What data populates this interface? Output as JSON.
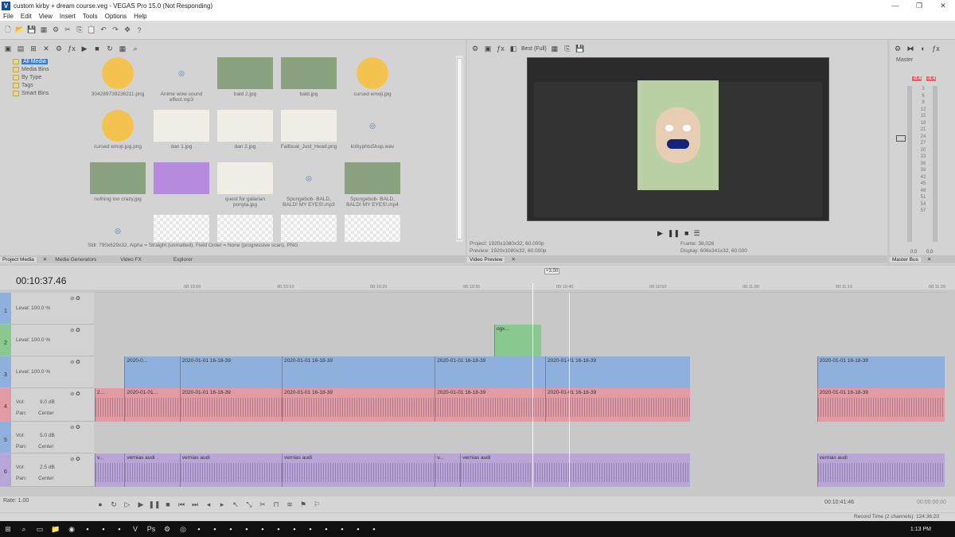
{
  "window": {
    "title": "custom kirby + dream course.veg - VEGAS Pro 15.0 (Not Responding)",
    "app_icon": "V"
  },
  "menu": [
    "File",
    "Edit",
    "View",
    "Insert",
    "Tools",
    "Options",
    "Help"
  ],
  "media_tree": [
    {
      "label": "All Media",
      "selected": true
    },
    {
      "label": "Media Bins"
    },
    {
      "label": "By Type"
    },
    {
      "label": "Tags"
    },
    {
      "label": "Smart Bins"
    }
  ],
  "media_items": [
    {
      "name": "304289739236211.png",
      "kind": "emoji"
    },
    {
      "name": "Anime wow sound effect.mp3",
      "kind": "audio"
    },
    {
      "name": "bald 2.jpg",
      "kind": "photo"
    },
    {
      "name": "bald.jpg",
      "kind": "photo"
    },
    {
      "name": "cursed emoji.jpg",
      "kind": "emoji"
    },
    {
      "name": "cursed emoji.jpg.png",
      "kind": "emoji"
    },
    {
      "name": "dan 1.jpg",
      "kind": "drawing"
    },
    {
      "name": "dan 2.jpg",
      "kind": "drawing"
    },
    {
      "name": "Failboat_Just_Head.png",
      "kind": "drawing"
    },
    {
      "name": "kirbyphto5hop.wav",
      "kind": "audio"
    },
    {
      "name": "nothing too crazy.jpg",
      "kind": "photo"
    },
    {
      "name": "",
      "kind": "purple"
    },
    {
      "name": "quest for galarian ponyta.jpg",
      "kind": "drawing"
    },
    {
      "name": "Spongebob- BALD, BALD! MY EYES!.mp3",
      "kind": "audio"
    },
    {
      "name": "Spongebob- BALD, BALD! MY EYES!.mp4",
      "kind": "photo"
    },
    {
      "name": "",
      "kind": "audio"
    },
    {
      "name": "",
      "kind": "checker"
    },
    {
      "name": "",
      "kind": "checker"
    },
    {
      "name": "",
      "kind": "checker"
    },
    {
      "name": "",
      "kind": "checker"
    }
  ],
  "media_status": "Still: 790x629x32, Alpha = Straight (unmatted), Field Order = None (progressive scan), PNG",
  "left_tabs": [
    "Project Media",
    "Media Generators",
    "Video FX",
    "Explorer"
  ],
  "preview": {
    "quality": "Best (Full)",
    "project": "Project:  1920x1080x32, 60.000p",
    "preview": "Preview:  1920x1080x32, 60.000p",
    "frame": "Frame:     38,026",
    "display": "Display:   606x341x32, 60.000",
    "tab": "Video Preview"
  },
  "master": {
    "label": "Master",
    "tab": "Master Bus",
    "peak_left": "-9.4",
    "peak_right": "-9.4",
    "scale": [
      "3",
      "6",
      "9",
      "12",
      "15",
      "18",
      "21",
      "24",
      "27",
      "30",
      "33",
      "36",
      "39",
      "42",
      "45",
      "48",
      "51",
      "54",
      "57"
    ],
    "bottom_left": "0.0",
    "bottom_right": "0.0"
  },
  "timeline": {
    "timecode": "00:10:37.46",
    "rate_marker": "+3.00",
    "ruler": [
      "00:10:00",
      "00:10:10",
      "00:10:20",
      "00:10:30",
      "00:10:40",
      "00:10:50",
      "00:11:00",
      "00:11:10",
      "00:11:20"
    ],
    "tracks": [
      {
        "num": "1",
        "label": "Level: 100.0 %",
        "color": "#8fb0dc",
        "type": "video"
      },
      {
        "num": "2",
        "label": "Level: 100.0 %",
        "color": "#89c98f",
        "type": "video"
      },
      {
        "num": "3",
        "label": "Level: 100.0 %",
        "color": "#8fb0dc",
        "type": "video"
      },
      {
        "num": "4",
        "vol": "Vol:",
        "vol_val": "9.0 dB",
        "pan": "Pan:",
        "pan_val": "Center",
        "color": "#e29aa3",
        "type": "audio"
      },
      {
        "num": "5",
        "vol": "Vol:",
        "vol_val": "5.0 dB",
        "pan": "Pan:",
        "pan_val": "Center",
        "color": "#8fb0dc",
        "type": "audio"
      },
      {
        "num": "6",
        "vol": "Vol:",
        "vol_val": "2.5 dB",
        "pan": "Pan:",
        "pan_val": "Center",
        "color": "#b8a6d8",
        "type": "audio"
      }
    ],
    "clips": {
      "t2": [
        {
          "name": "ogx...",
          "start": 0.47,
          "end": 0.525
        }
      ],
      "t3": [
        {
          "name": "2020-0...",
          "start": 0.035,
          "end": 0.1
        },
        {
          "name": "2020-01-01 16-18-39",
          "start": 0.1,
          "end": 0.22
        },
        {
          "name": "2020-01-01 16-18-39",
          "start": 0.22,
          "end": 0.4
        },
        {
          "name": "2020-01-01 16-18-39",
          "start": 0.4,
          "end": 0.53
        },
        {
          "name": "2020-01-01 16-18-39",
          "start": 0.53,
          "end": 0.7
        },
        {
          "name": "2020-01-01 16-18-39",
          "start": 0.85,
          "end": 1.0
        }
      ],
      "t4": [
        {
          "name": "2...",
          "start": 0.0,
          "end": 0.035
        },
        {
          "name": "2020-01-01...",
          "start": 0.035,
          "end": 0.1
        },
        {
          "name": "2020-01-01 16-18-39",
          "start": 0.1,
          "end": 0.22
        },
        {
          "name": "2020-01-01 16-18-39",
          "start": 0.22,
          "end": 0.4
        },
        {
          "name": "2020-01-01 16-18-39",
          "start": 0.4,
          "end": 0.53
        },
        {
          "name": "2020-01-01 16-18-39",
          "start": 0.53,
          "end": 0.7
        },
        {
          "name": "2020-01-01 16-18-39",
          "start": 0.85,
          "end": 1.0
        }
      ],
      "t6": [
        {
          "name": "v...",
          "start": 0.0,
          "end": 0.035
        },
        {
          "name": "vernias audi",
          "start": 0.035,
          "end": 0.1
        },
        {
          "name": "vernias audi",
          "start": 0.1,
          "end": 0.22
        },
        {
          "name": "vernias audi",
          "start": 0.22,
          "end": 0.4
        },
        {
          "name": "v...",
          "start": 0.4,
          "end": 0.43
        },
        {
          "name": "vernias audi",
          "start": 0.43,
          "end": 0.7
        },
        {
          "name": "vernias audi",
          "start": 0.85,
          "end": 1.0
        }
      ]
    },
    "rate": "Rate: 1.00",
    "cursor_time": "00:10:41:46",
    "end_time": "00:00:00;00"
  },
  "status": "Record Time (2 channels): 124:36:20",
  "taskbar": {
    "time": "1:13 PM",
    "apps": [
      "windows-icon",
      "search-icon",
      "taskview-icon",
      "explorer-icon",
      "chrome-icon",
      "app",
      "app",
      "app",
      "vegas-icon",
      "photoshop-icon",
      "steam-icon",
      "obs-icon",
      "app",
      "app",
      "app",
      "app",
      "app",
      "app",
      "app",
      "app",
      "app",
      "app",
      "app",
      "app"
    ]
  }
}
